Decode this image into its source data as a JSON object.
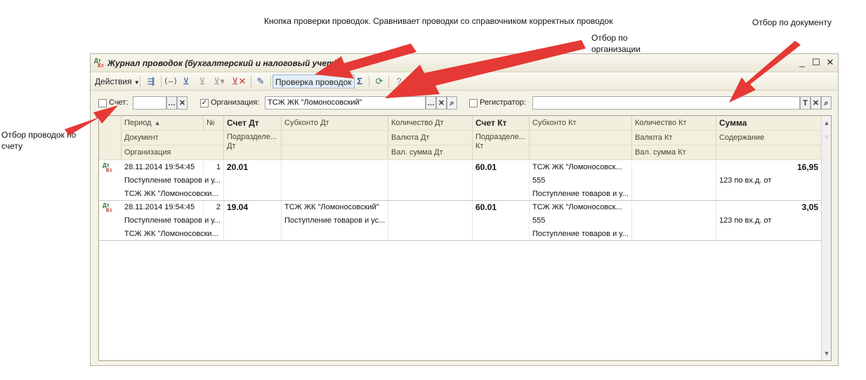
{
  "annotations": {
    "check_button": "Кнопка проверки проводок. Сравнивает проводки со справочником корректных проводок",
    "org_filter": "Отбор по организации",
    "doc_filter": "Отбор по документу",
    "account_filter": "Отбор проводок по счету"
  },
  "window": {
    "title": "Журнал проводок (бухгалтерский и налоговый учет)",
    "title_icon": "dt-kt-icon"
  },
  "toolbar": {
    "actions_label": "Действия",
    "check_label": "Проверка проводок"
  },
  "filters": {
    "account_label": "Счет:",
    "account_value": "",
    "account_checked": false,
    "org_label": "Организация:",
    "org_value": "ТСЖ ЖК \"Ломоносовский\"",
    "org_checked": true,
    "registrar_label": "Регистратор:",
    "registrar_value": "",
    "registrar_checked": false
  },
  "columns": {
    "period": "Период",
    "num": "№",
    "document": "Документ",
    "organization": "Организация",
    "acct_dt": "Счет Дт",
    "division_dt": "Подразделе... Дт",
    "subconto_dt": "Субконто Дт",
    "qty_dt": "Количество Дт",
    "curr_dt": "Валюта Дт",
    "curr_sum_dt": "Вал. сумма Дт",
    "acct_kt": "Счет Кт",
    "division_kt": "Подразделе... Кт",
    "subconto_kt": "Субконто Кт",
    "qty_kt": "Количество Кт",
    "curr_kt": "Валюта Кт",
    "curr_sum_kt": "Вал. сумма Кт",
    "sum": "Сумма",
    "content": "Содержание"
  },
  "rows": [
    {
      "period": "28.11.2014 19:54:45",
      "num": "1",
      "document": "Поступление товаров и у...",
      "organization": "ТСЖ ЖК \"Ломоносовски...",
      "acct_dt": "20.01",
      "subconto_dt_1": "",
      "subconto_dt_2": "",
      "acct_kt": "60.01",
      "subconto_kt_1": "ТСЖ ЖК \"Ломоносовск...",
      "subconto_kt_2": "555",
      "subconto_kt_3": "Поступление товаров и у...",
      "sum": "16,95",
      "content": "123 по вх.д. от"
    },
    {
      "period": "28.11.2014 19:54:45",
      "num": "2",
      "document": "Поступление товаров и у...",
      "organization": "ТСЖ ЖК \"Ломоносовски...",
      "acct_dt": "19.04",
      "subconto_dt_1": "ТСЖ ЖК \"Ломоносовский\"",
      "subconto_dt_2": "Поступление товаров и ус...",
      "acct_kt": "60.01",
      "subconto_kt_1": "ТСЖ ЖК \"Ломоносовск...",
      "subconto_kt_2": "555",
      "subconto_kt_3": "Поступление товаров и у...",
      "sum": "3,05",
      "content": "123 по вх.д. от"
    }
  ]
}
